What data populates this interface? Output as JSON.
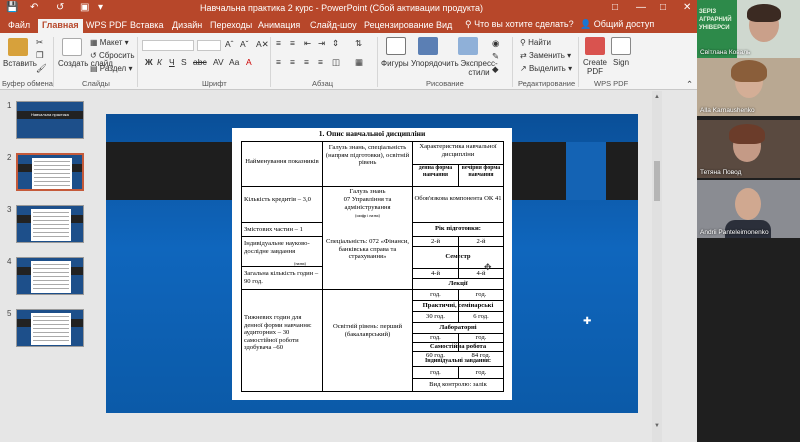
{
  "window": {
    "title": "Навчальна практика 2 курс - PowerPoint (Сбой активации продукта)"
  },
  "tabs": [
    {
      "label": "Файл"
    },
    {
      "label": "Главная"
    },
    {
      "label": "WPS PDF"
    },
    {
      "label": "Вставка"
    },
    {
      "label": "Дизайн"
    },
    {
      "label": "Переходы"
    },
    {
      "label": "Анимация"
    },
    {
      "label": "Слайд-шоу"
    },
    {
      "label": "Рецензирование"
    },
    {
      "label": "Вид"
    }
  ],
  "tell_me": "Что вы хотите сделать?",
  "share": "Общий доступ",
  "ribbon": {
    "paste": "Вставить",
    "create_slide": "Создать слайд",
    "layout": "Макет",
    "reset": "Сбросить",
    "section": "Раздел",
    "shapes": "Фигуры",
    "arrange": "Упорядочить",
    "express_styles": "Экспресс-стили",
    "find": "Найти",
    "replace": "Заменить",
    "select": "Выделить",
    "create_pdf": "Create PDF",
    "sign": "Sign",
    "groups": {
      "clipboard": "Буфер обмена",
      "slides": "Слайды",
      "font": "Шрифт",
      "paragraph": "Абзац",
      "drawing": "Рисование",
      "editing": "Редактирование",
      "wps_pdf": "WPS PDF"
    }
  },
  "slides": [
    {
      "num": "1",
      "title": "Навчальна практика"
    },
    {
      "num": "2"
    },
    {
      "num": "3"
    },
    {
      "num": "4"
    },
    {
      "num": "5"
    }
  ],
  "document": {
    "heading": "1. Опис навчальної дисципліни",
    "col1_header": "Найменування показників",
    "col2_header": "Галузь знань, спеціальність (напрям підготовки), освітній рівень",
    "col3_header": "Характеристика навчальної дисципліни",
    "col3a_header": "денна форма навчання",
    "col3b_header": "вечірня форма навчання",
    "credits": "Кількість кредитів – 3,0",
    "field_label": "Галузь знань",
    "field_value": "07 Управління та адміністрування",
    "field_note": "(шифр і назва)",
    "component": "Обов'язкова компонента ОК 41",
    "modules": "Змістових частин – 1",
    "year_label": "Рік підготовки:",
    "year_a": "2-й",
    "year_b": "2-й",
    "individual": "Індивідуальне науково-дослідне завдання",
    "individual_note": "(назва)",
    "specialty": "Спеціальність: 072 «Фінанси, банківська справа та страхування»",
    "semester_label": "Семестр",
    "total_hours": "Загальна кількість годин – 90 год.",
    "sem_a": "4-й",
    "sem_b": "4-й",
    "lectures": "Лекції",
    "hours_unit": "год.",
    "practical": "Практичні, семінарські",
    "practical_a": "30 год.",
    "practical_b": "6 год.",
    "labs": "Лабораторні",
    "weekly": "Тижневих годин для денної форми навчання: аудиторних – 30 самостійної роботи здобувача –60",
    "level": "Освітній рівень: перший (бакалаврський)",
    "selfwork": "Самостійна робота",
    "selfwork_a": "60 год.",
    "selfwork_b": "84 год.",
    "indiv_tasks": "Індивідуальні завдання:",
    "control": "Вид контролю: залік"
  },
  "participants": [
    {
      "name": "Світлана Коваль",
      "banner": "ЗЕРІЗ АГРАРНИЙ УНІВЕРСИ"
    },
    {
      "name": "Alla Karnaushenko"
    },
    {
      "name": "Тетяна Повод"
    },
    {
      "name": "Andrii Panteleimonenko"
    }
  ]
}
